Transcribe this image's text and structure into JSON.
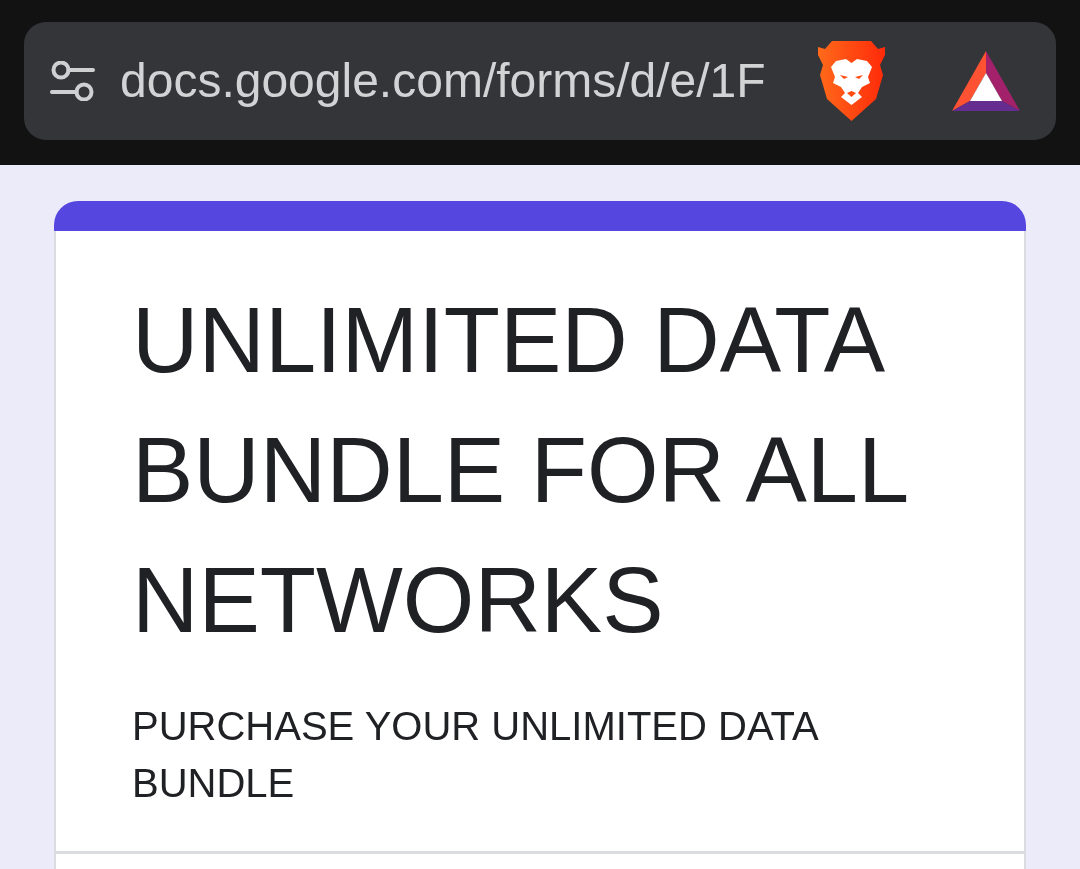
{
  "browser_bar": {
    "url": "docs.google.com/forms/d/e/1F"
  },
  "form": {
    "title": "UNLIMITED DATA BUNDLE FOR ALL NETWORKS",
    "description": "PURCHASE YOUR UNLIMITED DATA BUNDLE"
  }
}
